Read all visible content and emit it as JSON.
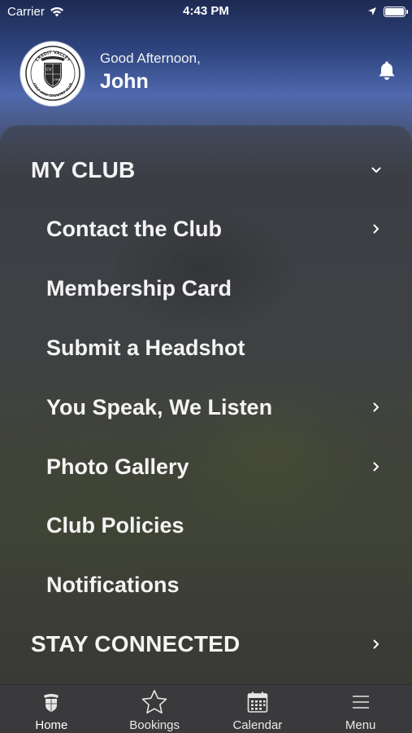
{
  "status_bar": {
    "carrier": "Carrier",
    "time": "4:43 PM"
  },
  "header": {
    "greeting": "Good Afternoon,",
    "name": "John",
    "logo": {
      "top_text": "CREDIT VALLEY",
      "bottom_text": "GOLF AND COUNTRY CLUB",
      "year": "1956"
    }
  },
  "menu": {
    "section_my_club": "MY CLUB",
    "items": [
      {
        "label": "Contact the Club",
        "has_chevron": true
      },
      {
        "label": "Membership Card",
        "has_chevron": false
      },
      {
        "label": "Submit a Headshot",
        "has_chevron": false
      },
      {
        "label": "You Speak, We Listen",
        "has_chevron": true
      },
      {
        "label": "Photo Gallery",
        "has_chevron": true
      },
      {
        "label": "Club Policies",
        "has_chevron": false
      },
      {
        "label": "Notifications",
        "has_chevron": false
      }
    ],
    "section_stay_connected": "STAY CONNECTED"
  },
  "tabs": [
    {
      "label": "Home",
      "icon": "club-crest-icon"
    },
    {
      "label": "Bookings",
      "icon": "star-icon"
    },
    {
      "label": "Calendar",
      "icon": "calendar-icon"
    },
    {
      "label": "Menu",
      "icon": "hamburger-icon"
    }
  ]
}
